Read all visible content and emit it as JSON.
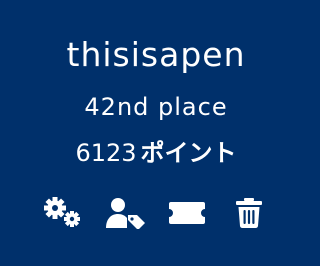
{
  "profile": {
    "username": "thisisapen",
    "rank": "42nd place",
    "points_value": "6123",
    "points_unit": "ポイント"
  },
  "actions": [
    {
      "icon": "gears-icon"
    },
    {
      "icon": "user-tag-icon"
    },
    {
      "icon": "ticket-icon"
    },
    {
      "icon": "trash-icon"
    }
  ],
  "colors": {
    "background": "#00306b",
    "text": "#ffffff"
  }
}
